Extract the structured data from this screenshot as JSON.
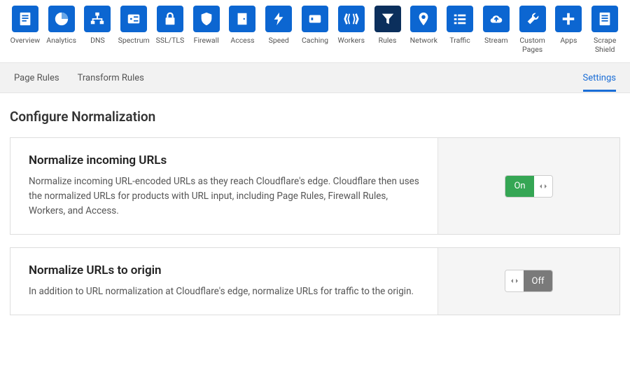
{
  "nav": [
    {
      "id": "overview",
      "label": "Overview",
      "icon": "document"
    },
    {
      "id": "analytics",
      "label": "Analytics",
      "icon": "pie"
    },
    {
      "id": "dns",
      "label": "DNS",
      "icon": "hierarchy"
    },
    {
      "id": "spectrum",
      "label": "Spectrum",
      "icon": "server"
    },
    {
      "id": "ssltls",
      "label": "SSL/TLS",
      "icon": "lock"
    },
    {
      "id": "firewall",
      "label": "Firewall",
      "icon": "shield"
    },
    {
      "id": "access",
      "label": "Access",
      "icon": "door"
    },
    {
      "id": "speed",
      "label": "Speed",
      "icon": "bolt"
    },
    {
      "id": "caching",
      "label": "Caching",
      "icon": "drive"
    },
    {
      "id": "workers",
      "label": "Workers",
      "icon": "brackets"
    },
    {
      "id": "rules",
      "label": "Rules",
      "icon": "funnel",
      "active": true
    },
    {
      "id": "network",
      "label": "Network",
      "icon": "pin"
    },
    {
      "id": "traffic",
      "label": "Traffic",
      "icon": "list"
    },
    {
      "id": "stream",
      "label": "Stream",
      "icon": "cloud-up"
    },
    {
      "id": "custom-pages",
      "label": "Custom\nPages",
      "icon": "wrench"
    },
    {
      "id": "apps",
      "label": "Apps",
      "icon": "plus"
    },
    {
      "id": "scrape-shield",
      "label": "Scrape\nShield",
      "icon": "document2"
    }
  ],
  "subnav": {
    "left": [
      {
        "id": "page-rules",
        "label": "Page Rules"
      },
      {
        "id": "transform-rules",
        "label": "Transform Rules"
      }
    ],
    "right": {
      "id": "settings",
      "label": "Settings",
      "active": true
    }
  },
  "page": {
    "title": "Configure Normalization"
  },
  "cards": [
    {
      "id": "normalize-incoming",
      "title": "Normalize incoming URLs",
      "desc": "Normalize incoming URL-encoded URLs as they reach Cloudflare's edge. Cloudflare then uses the normalized URLs for products with URL input, including Page Rules, Firewall Rules, Workers, and Access.",
      "toggle": {
        "state": "on",
        "on_label": "On",
        "off_label": "Off"
      }
    },
    {
      "id": "normalize-origin",
      "title": "Normalize URLs to origin",
      "desc": "In addition to URL normalization at Cloudflare's edge, normalize URLs for traffic to the origin.",
      "toggle": {
        "state": "off",
        "on_label": "On",
        "off_label": "Off"
      }
    }
  ],
  "colors": {
    "brand_blue": "#0c66d1",
    "brand_blue_dark": "#0b2f5c",
    "toggle_on": "#35a654",
    "toggle_off": "#7a7a7a"
  }
}
